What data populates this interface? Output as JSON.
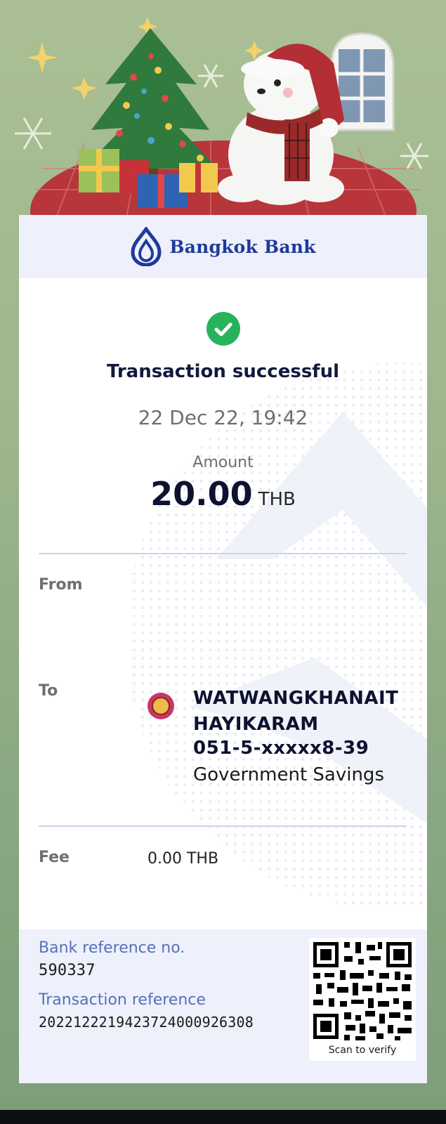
{
  "brand": {
    "name": "Bangkok Bank",
    "color": "#1f3a9a"
  },
  "status": {
    "icon": "check-circle-icon",
    "title": "Transaction successful",
    "color": "#27b35a"
  },
  "datetime": "22 Dec 22, 19:42",
  "amount": {
    "label": "Amount",
    "value": "20.00",
    "currency": "THB"
  },
  "from": {
    "label": "From"
  },
  "to": {
    "label": "To",
    "name_line1": "WATWANGKHANAIT",
    "name_line2": "HAYIKARAM",
    "account": "051-5-xxxxx8-39",
    "bank": "Government Savings"
  },
  "fee": {
    "label": "Fee",
    "value": "0.00 THB"
  },
  "footer": {
    "bank_ref_label": "Bank reference no.",
    "bank_ref_value": "590337",
    "txn_ref_label": "Transaction reference",
    "txn_ref_value": "2022122219423724000926308",
    "qr_caption": "Scan to verify"
  }
}
